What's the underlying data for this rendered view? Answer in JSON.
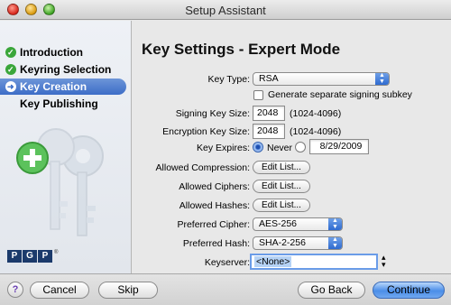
{
  "window": {
    "title": "Setup Assistant"
  },
  "sidebar": {
    "steps": [
      {
        "label": "Introduction",
        "state": "done"
      },
      {
        "label": "Keyring Selection",
        "state": "done"
      },
      {
        "label": "Key Creation",
        "state": "current"
      },
      {
        "label": "Key Publishing",
        "state": "pending"
      }
    ],
    "logo_letters": [
      "P",
      "G",
      "P"
    ],
    "logo_mark": "®"
  },
  "main": {
    "title": "Key Settings - Expert Mode",
    "key_type": {
      "label": "Key Type:",
      "value": "RSA"
    },
    "signing_subkey": {
      "label": "Generate separate signing subkey",
      "checked": false
    },
    "signing_key_size": {
      "label": "Signing Key Size:",
      "value": "2048",
      "range": "(1024-4096)"
    },
    "encryption_key_size": {
      "label": "Encryption Key Size:",
      "value": "2048",
      "range": "(1024-4096)"
    },
    "key_expires": {
      "label": "Key Expires:",
      "never_label": "Never",
      "selected": "never",
      "date": "8/29/2009"
    },
    "allowed_compression": {
      "label": "Allowed Compression:",
      "button": "Edit List..."
    },
    "allowed_ciphers": {
      "label": "Allowed Ciphers:",
      "button": "Edit List..."
    },
    "allowed_hashes": {
      "label": "Allowed Hashes:",
      "button": "Edit List..."
    },
    "preferred_cipher": {
      "label": "Preferred Cipher:",
      "value": "AES-256"
    },
    "preferred_hash": {
      "label": "Preferred Hash:",
      "value": "SHA-2-256"
    },
    "keyserver": {
      "label": "Keyserver:",
      "value": "<None>"
    }
  },
  "footer": {
    "help": "?",
    "cancel": "Cancel",
    "skip": "Skip",
    "go_back": "Go Back",
    "continue": "Continue"
  },
  "colors": {
    "accent": "#3c6dc7",
    "done": "#3aa63a",
    "primary_button": "#4b8ee8"
  }
}
